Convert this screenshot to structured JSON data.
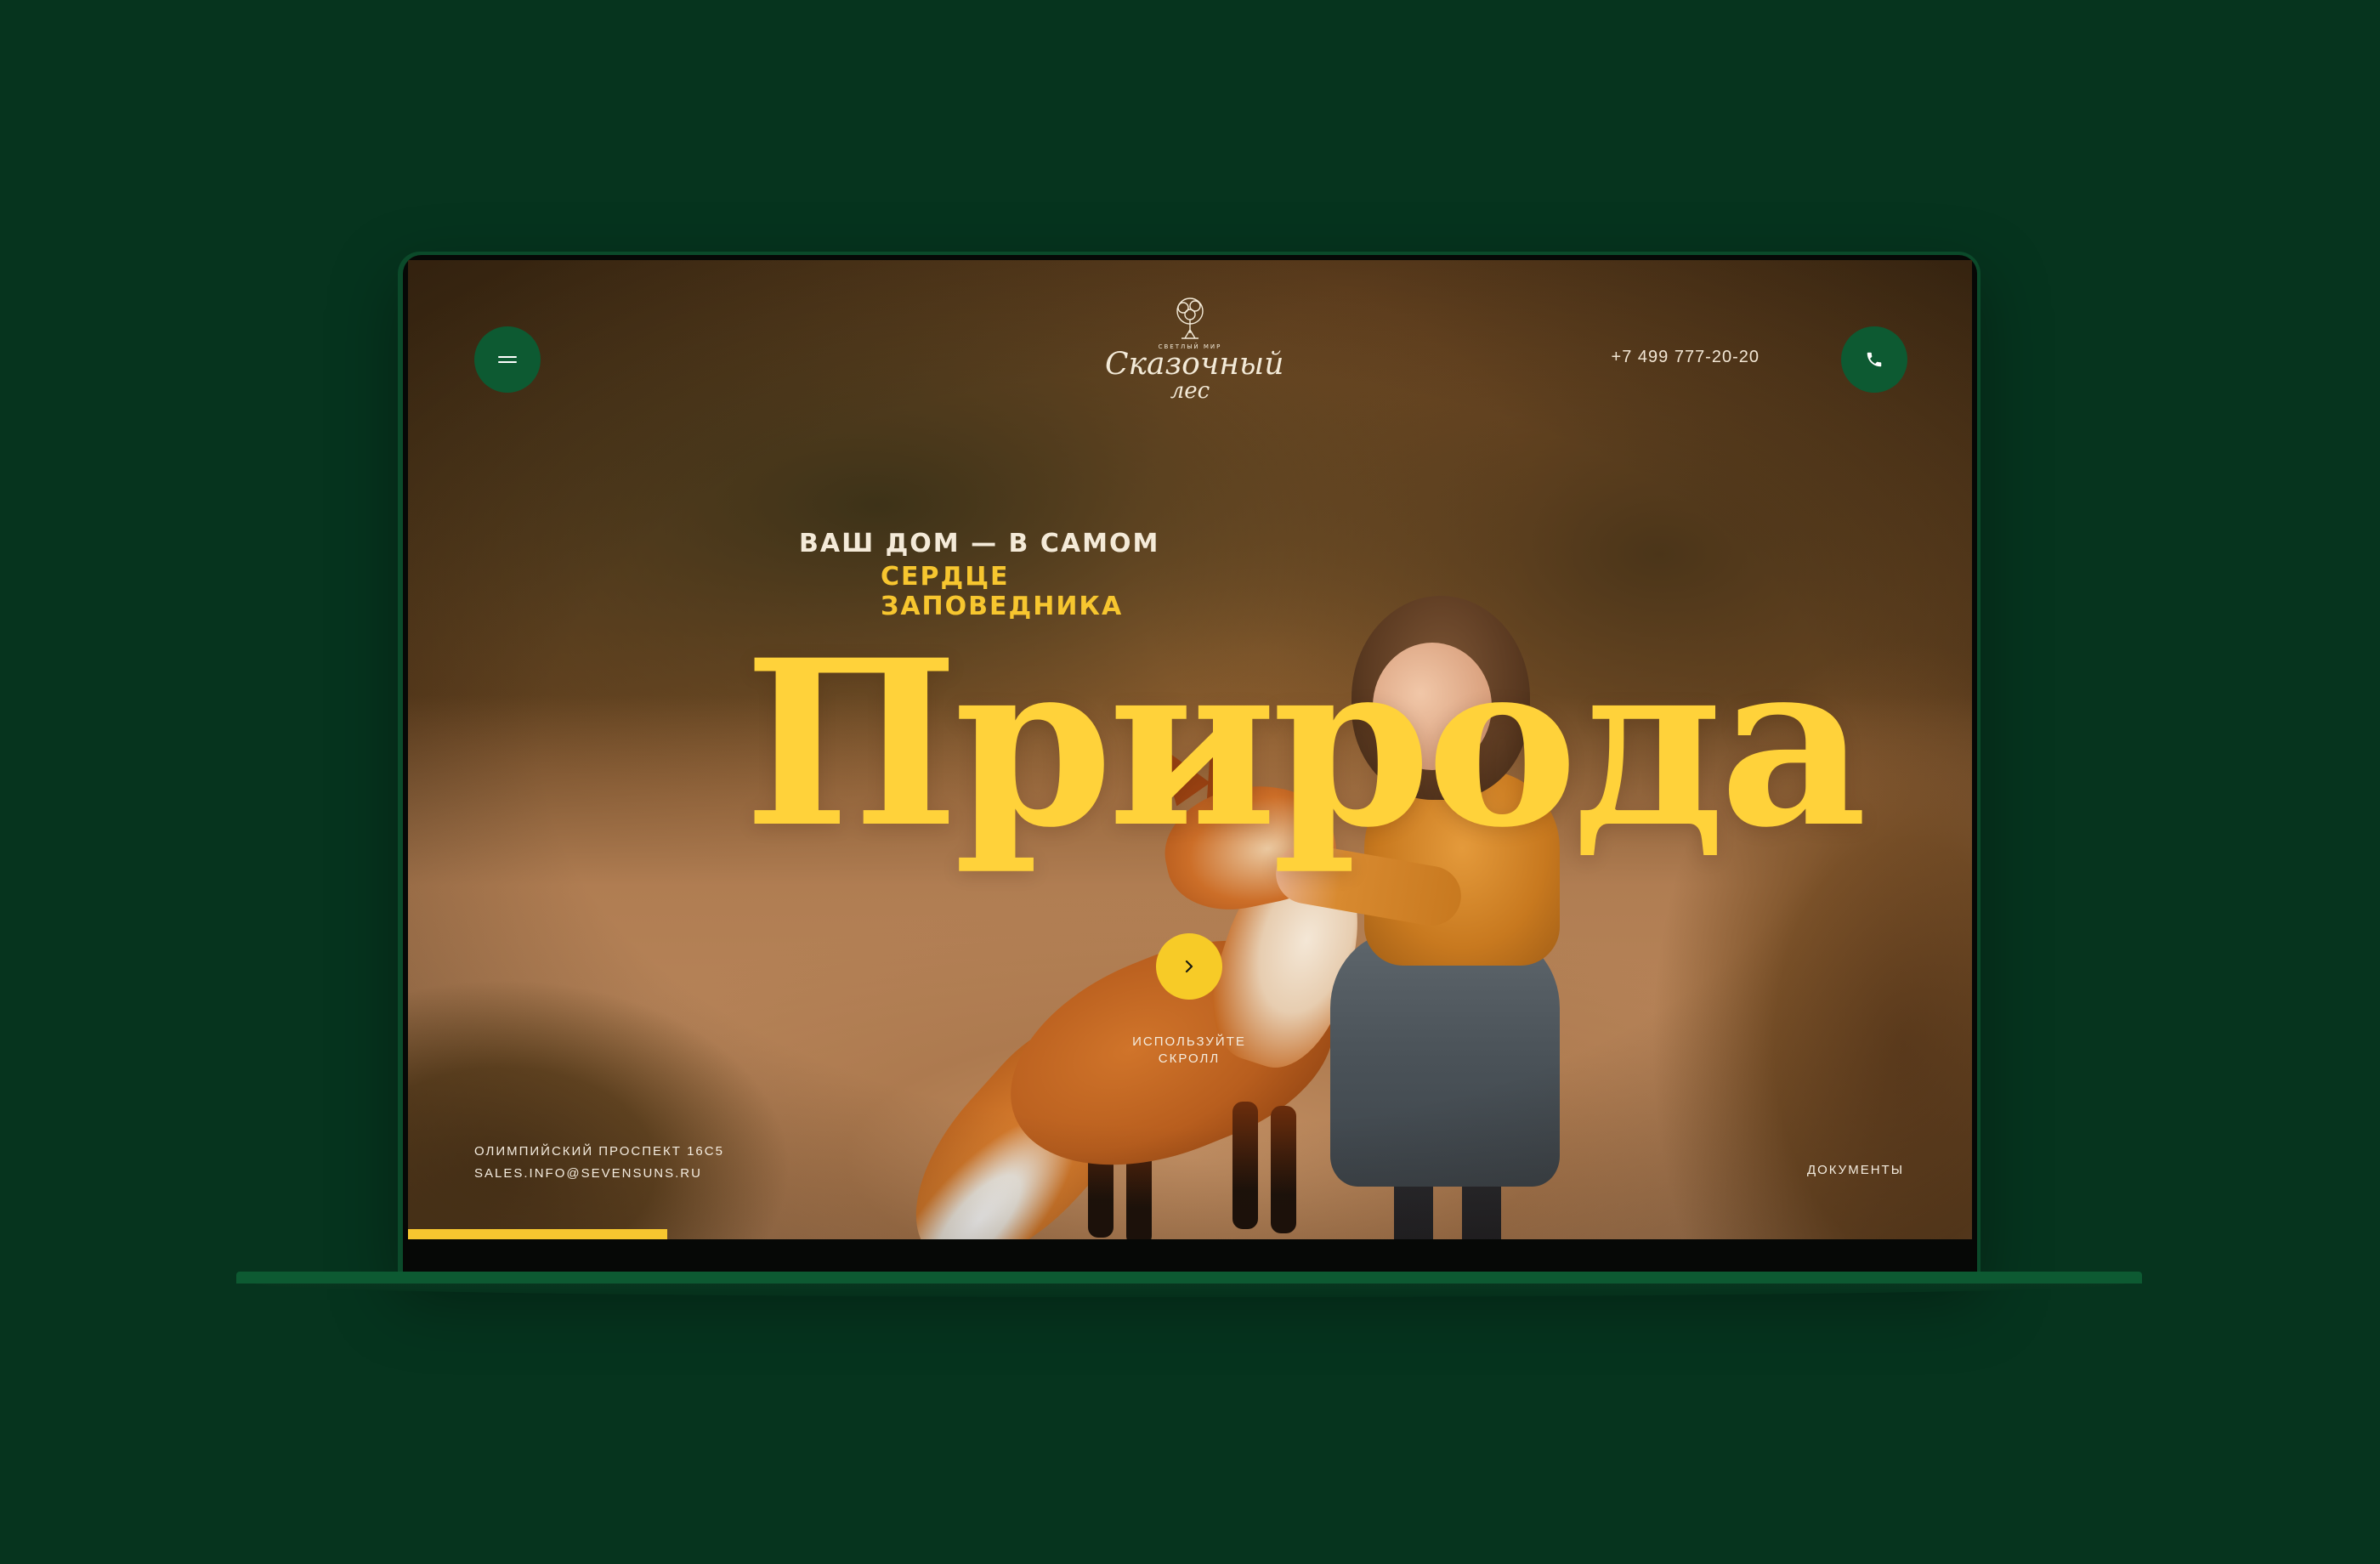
{
  "header": {
    "logo": {
      "small_text": "СВЕТЛЫЙ МИР",
      "title_line1": "Сказочный",
      "title_line2": "лес"
    },
    "phone": "+7 499 777-20-20",
    "menu_icon": "hamburger-menu-icon",
    "call_icon": "phone-icon"
  },
  "hero": {
    "tagline_line1": "ВАШ ДОМ — В САМОМ",
    "tagline_line2": "СЕРДЦЕ ЗАПОВЕДНИКА",
    "headline": "Природа",
    "scroll_icon": "chevron-right-icon",
    "scroll_hint_line1": "используйте",
    "scroll_hint_line2": "скролл"
  },
  "footer": {
    "address": "ОЛИМПИЙСКИЙ ПРОСПЕКТ 16С5",
    "email": "SALES.INFO@SEVENSUNS.RU",
    "documents_link": "ДОКУМЕНТЫ"
  },
  "progress": {
    "fraction": 0.166
  },
  "colors": {
    "background": "#06341e",
    "brand_green": "#0d5a32",
    "accent_yellow": "#f7c62f",
    "headline_yellow": "#ffd23a"
  }
}
